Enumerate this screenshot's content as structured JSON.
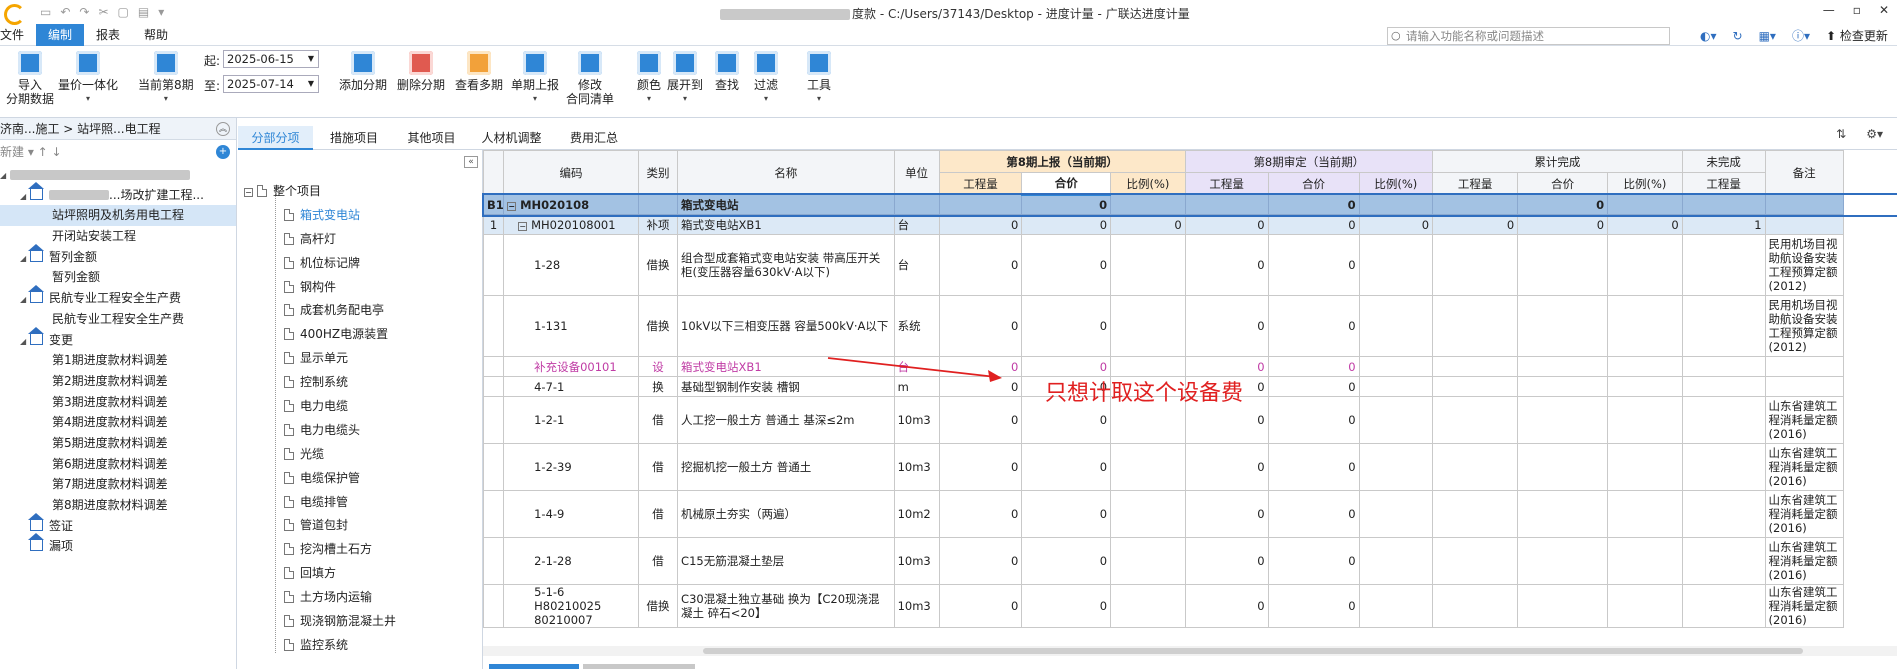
{
  "window": {
    "title_path": "度款 - C:/Users/37143/Desktop - 进度计量 - 广联达进度计量",
    "quick_access": [
      "▭",
      "↶",
      "↷",
      "✂",
      "▢",
      "▤",
      "▾"
    ],
    "controls": [
      "—",
      "▫",
      "✕"
    ]
  },
  "menubar": {
    "items": [
      "文件",
      "编制",
      "报表",
      "帮助"
    ],
    "search_placeholder": "请输入功能名称或问题描述",
    "check_update": "检查更新"
  },
  "ribbon": {
    "import_label": "导入",
    "import_sub": "分期数据",
    "qty_price_label": "量价一体化",
    "current_period_label": "当前第8期",
    "start_label": "起:",
    "start_date": "2025-06-15",
    "end_label": "至:",
    "end_date": "2025-07-14",
    "add_period": "添加分期",
    "delete_period": "删除分期",
    "view_multi": "查看多期",
    "single_report": "单期上报",
    "modify_label": "修改",
    "modify_sub": "合同清单",
    "color": "颜色",
    "expand_to": "展开到",
    "find": "查找",
    "filter": "过滤",
    "tools": "工具"
  },
  "leftpane": {
    "header": "济南...施工 > 站坪照...电工程",
    "new_label": "新建",
    "tree": [
      {
        "label": "",
        "level": 0,
        "type": "root"
      },
      {
        "label": "...场改扩建工程...",
        "level": 1,
        "type": "home"
      },
      {
        "label": "站坪照明及机务用电工程",
        "level": 2,
        "type": "leaf",
        "selected": true
      },
      {
        "label": "开闭站安装工程",
        "level": 2,
        "type": "leaf"
      },
      {
        "label": "暂列金额",
        "level": 1,
        "type": "home"
      },
      {
        "label": "暂列金额",
        "level": 2,
        "type": "leaf"
      },
      {
        "label": "民航专业工程安全生产费",
        "level": 1,
        "type": "home"
      },
      {
        "label": "民航专业工程安全生产费",
        "level": 2,
        "type": "leaf"
      },
      {
        "label": "变更",
        "level": 1,
        "type": "home"
      },
      {
        "label": "第1期进度款材料调差",
        "level": 2,
        "type": "leaf"
      },
      {
        "label": "第2期进度款材料调差",
        "level": 2,
        "type": "leaf"
      },
      {
        "label": "第3期进度款材料调差",
        "level": 2,
        "type": "leaf"
      },
      {
        "label": "第4期进度款材料调差",
        "level": 2,
        "type": "leaf"
      },
      {
        "label": "第5期进度款材料调差",
        "level": 2,
        "type": "leaf"
      },
      {
        "label": "第6期进度款材料调差",
        "level": 2,
        "type": "leaf"
      },
      {
        "label": "第7期进度款材料调差",
        "level": 2,
        "type": "leaf"
      },
      {
        "label": "第8期进度款材料调差",
        "level": 2,
        "type": "leaf"
      },
      {
        "label": "签证",
        "level": 1,
        "type": "home"
      },
      {
        "label": "漏项",
        "level": 1,
        "type": "home"
      }
    ]
  },
  "tabs": [
    "分部分项",
    "措施项目",
    "其他项目",
    "人材机调整",
    "费用汇总"
  ],
  "midtree": {
    "root": "整个项目",
    "items": [
      "箱式变电站",
      "高杆灯",
      "机位标记牌",
      "钢构件",
      "成套机务配电亭",
      "400HZ电源装置",
      "显示单元",
      "控制系统",
      "电力电缆",
      "电力电缆头",
      "光缆",
      "电缆保护管",
      "电缆排管",
      "管道包封",
      "挖沟槽土石方",
      "回填方",
      "土方场内运输",
      "现浇钢筋混凝土井",
      "监控系统"
    ]
  },
  "grid": {
    "headers": {
      "code": "编码",
      "type": "类别",
      "name": "名称",
      "unit": "单位",
      "period8_report": "第8期上报（当前期）",
      "period8_audit": "第8期审定（当前期）",
      "cumulative": "累计完成",
      "unfinished": "未完成",
      "remark": "备注",
      "qty": "工程量",
      "price": "合价",
      "ratio": "比例(%)"
    },
    "rows": [
      {
        "idx": "B1",
        "code": "MH020108",
        "type": "",
        "name": "箱式变电站",
        "unit": "",
        "r_qty": "",
        "r_price": "0",
        "r_ratio": "",
        "a_qty": "",
        "a_price": "0",
        "a_ratio": "",
        "c_qty": "",
        "c_price": "0",
        "c_ratio": "",
        "u_qty": "",
        "remark": "",
        "style": "b1"
      },
      {
        "idx": "1",
        "code": "MH020108001",
        "type": "补项",
        "name": "箱式变电站XB1",
        "unit": "台",
        "r_qty": "0",
        "r_price": "0",
        "r_ratio": "0",
        "a_qty": "0",
        "a_price": "0",
        "a_ratio": "0",
        "c_qty": "0",
        "c_price": "0",
        "c_ratio": "0",
        "u_qty": "1",
        "remark": "",
        "style": "item"
      },
      {
        "idx": "",
        "code": "1-28",
        "type": "借换",
        "name": "组合型成套箱式变电站安装 带高压开关柜(变压器容量630kV·A以下)",
        "unit": "台",
        "r_qty": "0",
        "r_price": "0",
        "r_ratio": "",
        "a_qty": "0",
        "a_price": "0",
        "a_ratio": "",
        "c_qty": "",
        "c_price": "",
        "c_ratio": "",
        "u_qty": "",
        "remark": "民用机场目视助航设备安装工程预算定额(2012)",
        "style": "tall"
      },
      {
        "idx": "",
        "code": "1-131",
        "type": "借换",
        "name": "10kV以下三相变压器 容量500kV·A以下",
        "unit": "系统",
        "r_qty": "0",
        "r_price": "0",
        "r_ratio": "",
        "a_qty": "0",
        "a_price": "0",
        "a_ratio": "",
        "c_qty": "",
        "c_price": "",
        "c_ratio": "",
        "u_qty": "",
        "remark": "民用机场目视助航设备安装工程预算定额(2012)",
        "style": "tall"
      },
      {
        "idx": "",
        "code": "补充设备00101",
        "type": "设",
        "name": "箱式变电站XB1",
        "unit": "台",
        "r_qty": "0",
        "r_price": "0",
        "r_ratio": "",
        "a_qty": "0",
        "a_price": "0",
        "a_ratio": "",
        "c_qty": "",
        "c_price": "",
        "c_ratio": "",
        "u_qty": "",
        "remark": "",
        "style": "pink"
      },
      {
        "idx": "",
        "code": "4-7-1",
        "type": "换",
        "name": "基础型钢制作安装 槽钢",
        "unit": "m",
        "r_qty": "0",
        "r_price": "0",
        "r_ratio": "",
        "a_qty": "0",
        "a_price": "0",
        "a_ratio": "",
        "c_qty": "",
        "c_price": "",
        "c_ratio": "",
        "u_qty": "",
        "remark": "",
        "style": "sub"
      },
      {
        "idx": "",
        "code": "1-2-1",
        "type": "借",
        "name": "人工挖一般土方 普通土 基深≤2m",
        "unit": "10m3",
        "r_qty": "0",
        "r_price": "0",
        "r_ratio": "",
        "a_qty": "0",
        "a_price": "0",
        "a_ratio": "",
        "c_qty": "",
        "c_price": "",
        "c_ratio": "",
        "u_qty": "",
        "remark": "山东省建筑工程消耗量定额(2016)",
        "style": "mid"
      },
      {
        "idx": "",
        "code": "1-2-39",
        "type": "借",
        "name": "挖掘机挖一般土方 普通土",
        "unit": "10m3",
        "r_qty": "0",
        "r_price": "0",
        "r_ratio": "",
        "a_qty": "0",
        "a_price": "0",
        "a_ratio": "",
        "c_qty": "",
        "c_price": "",
        "c_ratio": "",
        "u_qty": "",
        "remark": "山东省建筑工程消耗量定额(2016)",
        "style": "mid"
      },
      {
        "idx": "",
        "code": "1-4-9",
        "type": "借",
        "name": "机械原土夯实（两遍）",
        "unit": "10m2",
        "r_qty": "0",
        "r_price": "0",
        "r_ratio": "",
        "a_qty": "0",
        "a_price": "0",
        "a_ratio": "",
        "c_qty": "",
        "c_price": "",
        "c_ratio": "",
        "u_qty": "",
        "remark": "山东省建筑工程消耗量定额(2016)",
        "style": "mid"
      },
      {
        "idx": "",
        "code": "2-1-28",
        "type": "借",
        "name": "C15无筋混凝土垫层",
        "unit": "10m3",
        "r_qty": "0",
        "r_price": "0",
        "r_ratio": "",
        "a_qty": "0",
        "a_price": "0",
        "a_ratio": "",
        "c_qty": "",
        "c_price": "",
        "c_ratio": "",
        "u_qty": "",
        "remark": "山东省建筑工程消耗量定额(2016)",
        "style": "mid"
      },
      {
        "idx": "",
        "code": "5-1-6 H80210025 80210007",
        "type": "借换",
        "name": "C30混凝土独立基础 换为【C20现浇混凝土 碎石<20】",
        "unit": "10m3",
        "r_qty": "0",
        "r_price": "0",
        "r_ratio": "",
        "a_qty": "0",
        "a_price": "0",
        "a_ratio": "",
        "c_qty": "",
        "c_price": "",
        "c_ratio": "",
        "u_qty": "",
        "remark": "山东省建筑工程消耗量定额(2016)",
        "style": "big"
      }
    ]
  },
  "annotation": {
    "text": "只想计取这个设备费",
    "color": "#e02020"
  },
  "colors": {
    "accent": "#2f86d6",
    "report_header": "#fde8c9",
    "audit_header": "#e8e2f8",
    "selected_row": "#a3c2e3",
    "pink_row": "#c03ca5"
  }
}
